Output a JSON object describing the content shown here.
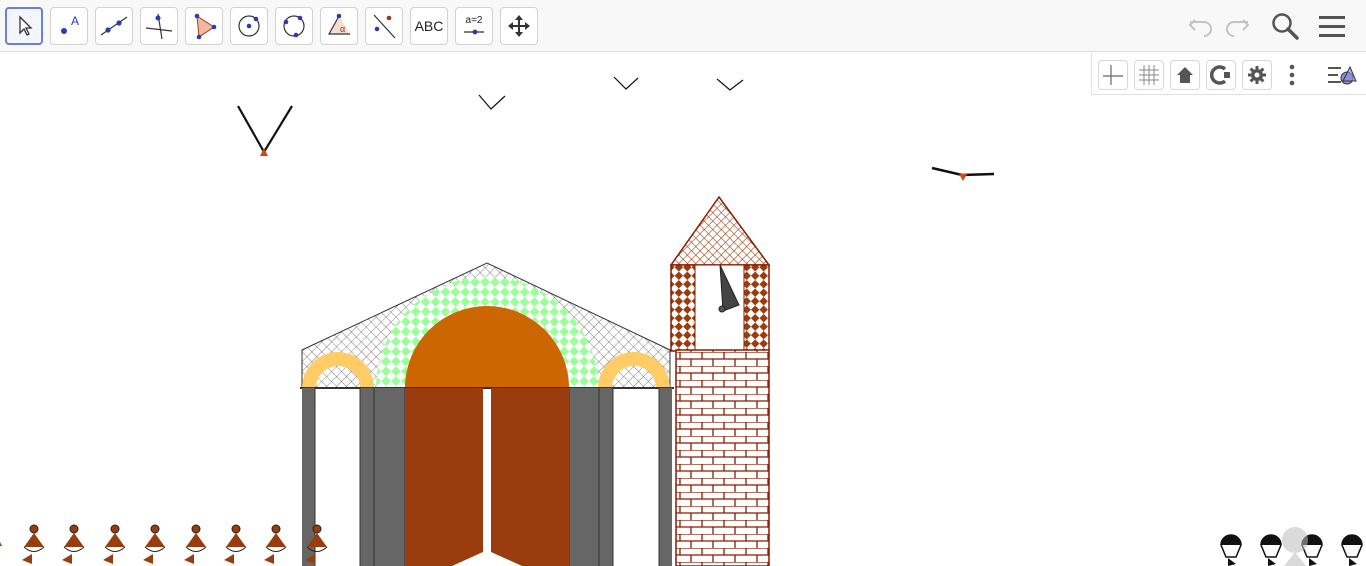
{
  "toolbar": {
    "tools": [
      {
        "id": "move",
        "icon": "move-arrow-icon",
        "selected": true
      },
      {
        "id": "point",
        "icon": "point-icon",
        "label": "A"
      },
      {
        "id": "line",
        "icon": "line-icon"
      },
      {
        "id": "perpendicular",
        "icon": "perpendicular-line-icon"
      },
      {
        "id": "polygon",
        "icon": "polygon-icon"
      },
      {
        "id": "circle",
        "icon": "circle-center-point-icon"
      },
      {
        "id": "circle-three-points",
        "icon": "circle-three-points-icon"
      },
      {
        "id": "angle",
        "icon": "angle-icon",
        "label": "α"
      },
      {
        "id": "reflect",
        "icon": "reflect-icon"
      },
      {
        "id": "text",
        "icon": "text-icon",
        "label": "ABC"
      },
      {
        "id": "slider",
        "icon": "slider-icon",
        "label": "a=2"
      },
      {
        "id": "move-graphics",
        "icon": "move-graphics-icon"
      }
    ],
    "right": {
      "undo_icon": "undo-icon",
      "redo_icon": "redo-icon",
      "search_icon": "search-icon",
      "menu_icon": "hamburger-menu-icon"
    }
  },
  "graphics_bar": {
    "buttons": [
      "axes-icon",
      "grid-icon",
      "home-icon",
      "point-capture-icon",
      "settings-gear-icon",
      "more-vertical-icon",
      "style-bar-toggle-icon"
    ]
  },
  "colors": {
    "accent": "#6d7fd6",
    "brown": "#9a3d0e",
    "orange": "#cc6600",
    "gray": "#666666",
    "green": "#99ff99",
    "gold": "#ffcc66",
    "dark_red": "#8b1a00"
  }
}
